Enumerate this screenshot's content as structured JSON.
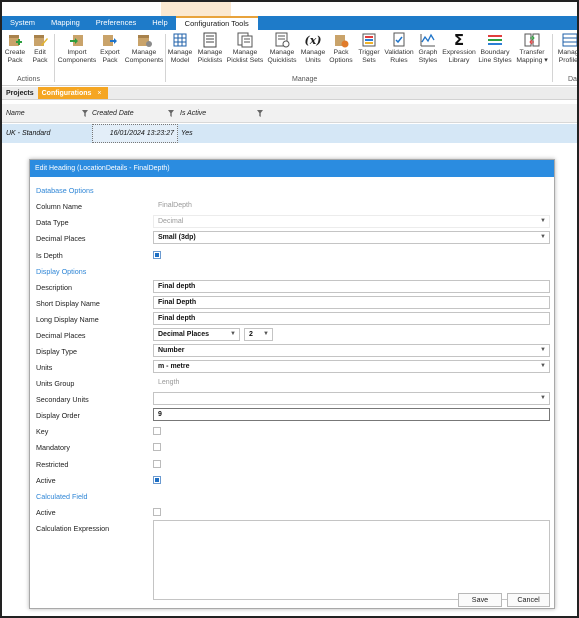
{
  "ribbon_tabs": [
    "System",
    "Mapping",
    "Preferences",
    "Help",
    "Configuration Tools"
  ],
  "ribbon_buttons": [
    {
      "label": "Create\nPack",
      "icon": "create-pack-icon"
    },
    {
      "label": "Edit\nPack",
      "icon": "edit-pack-icon"
    },
    {
      "label": "Import\nComponents",
      "icon": "import-icon"
    },
    {
      "label": "Export\nPack",
      "icon": "export-icon"
    },
    {
      "label": "Manage\nComponents",
      "icon": "manage-components-icon"
    },
    {
      "label": "Manage\nModel",
      "icon": "manage-model-icon"
    },
    {
      "label": "Manage\nPicklists",
      "icon": "picklists-icon"
    },
    {
      "label": "Manage\nPicklist Sets",
      "icon": "picklist-sets-icon"
    },
    {
      "label": "Manage\nQuicklists",
      "icon": "quicklists-icon"
    },
    {
      "label": "Manage\nUnits",
      "icon": "units-icon"
    },
    {
      "label": "Pack\nOptions",
      "icon": "pack-options-icon"
    },
    {
      "label": "Trigger\nSets",
      "icon": "trigger-sets-icon"
    },
    {
      "label": "Validation\nRules",
      "icon": "validation-rules-icon"
    },
    {
      "label": "Graph\nStyles",
      "icon": "graph-styles-icon"
    },
    {
      "label": "Expression\nLibrary",
      "icon": "sigma-icon"
    },
    {
      "label": "Boundary\nLine Styles",
      "icon": "line-styles-icon"
    },
    {
      "label": "Transfer\nMapping ▾",
      "icon": "transfer-mapping-icon"
    },
    {
      "label": "Manage\nProfiles",
      "icon": "manage-profiles-icon"
    }
  ],
  "ribbon_groups": [
    "Actions",
    "Manage",
    "Dat"
  ],
  "doc_tabs": {
    "projects": "Projects",
    "configurations": "Configurations",
    "close": "×"
  },
  "grid": {
    "columns": [
      "Name",
      "Created Date",
      "Is Active"
    ],
    "rows": [
      {
        "name": "UK - Standard",
        "created": "16/01/2024 13:23:27",
        "active": "Yes"
      }
    ]
  },
  "dialog": {
    "title": "Edit Heading (LocationDetails - FinalDepth)",
    "sections": {
      "database": "Database Options",
      "display": "Display Options",
      "calculated": "Calculated Field"
    },
    "labels": {
      "column_name": "Column Name",
      "data_type": "Data Type",
      "decimal_places": "Decimal Places",
      "is_depth": "Is Depth",
      "description": "Description",
      "short_display_name": "Short Display Name",
      "long_display_name": "Long Display Name",
      "decimal_places2": "Decimal Places",
      "display_type": "Display Type",
      "units": "Units",
      "units_group": "Units Group",
      "secondary_units": "Secondary Units",
      "display_order": "Display Order",
      "key": "Key",
      "mandatory": "Mandatory",
      "restricted": "Restricted",
      "active": "Active",
      "calc_active": "Active",
      "calculation_expression": "Calculation Expression"
    },
    "values": {
      "column_name": "FinalDepth",
      "data_type": "Decimal",
      "decimal_places": "Small (3dp)",
      "description": "Final depth",
      "short_display_name": "Final Depth",
      "long_display_name": "Final depth",
      "decimal_places_mode": "Decimal Places",
      "decimal_places_count": "2",
      "display_type": "Number",
      "units": "m - metre",
      "units_group": "Length",
      "secondary_units": "",
      "display_order": "9",
      "calculation_expression": ""
    },
    "checks": {
      "is_depth": true,
      "key": false,
      "mandatory": false,
      "restricted": false,
      "active": true,
      "calc_active": false
    },
    "buttons": {
      "save": "Save",
      "cancel": "Cancel"
    }
  },
  "colors": {
    "ribbon_blue": "#1e7bc9",
    "dialog_title": "#2b8ce0",
    "tab_orange": "#f5a623",
    "section_blue": "#2f86d6",
    "selected_row": "#d5e7f6"
  }
}
